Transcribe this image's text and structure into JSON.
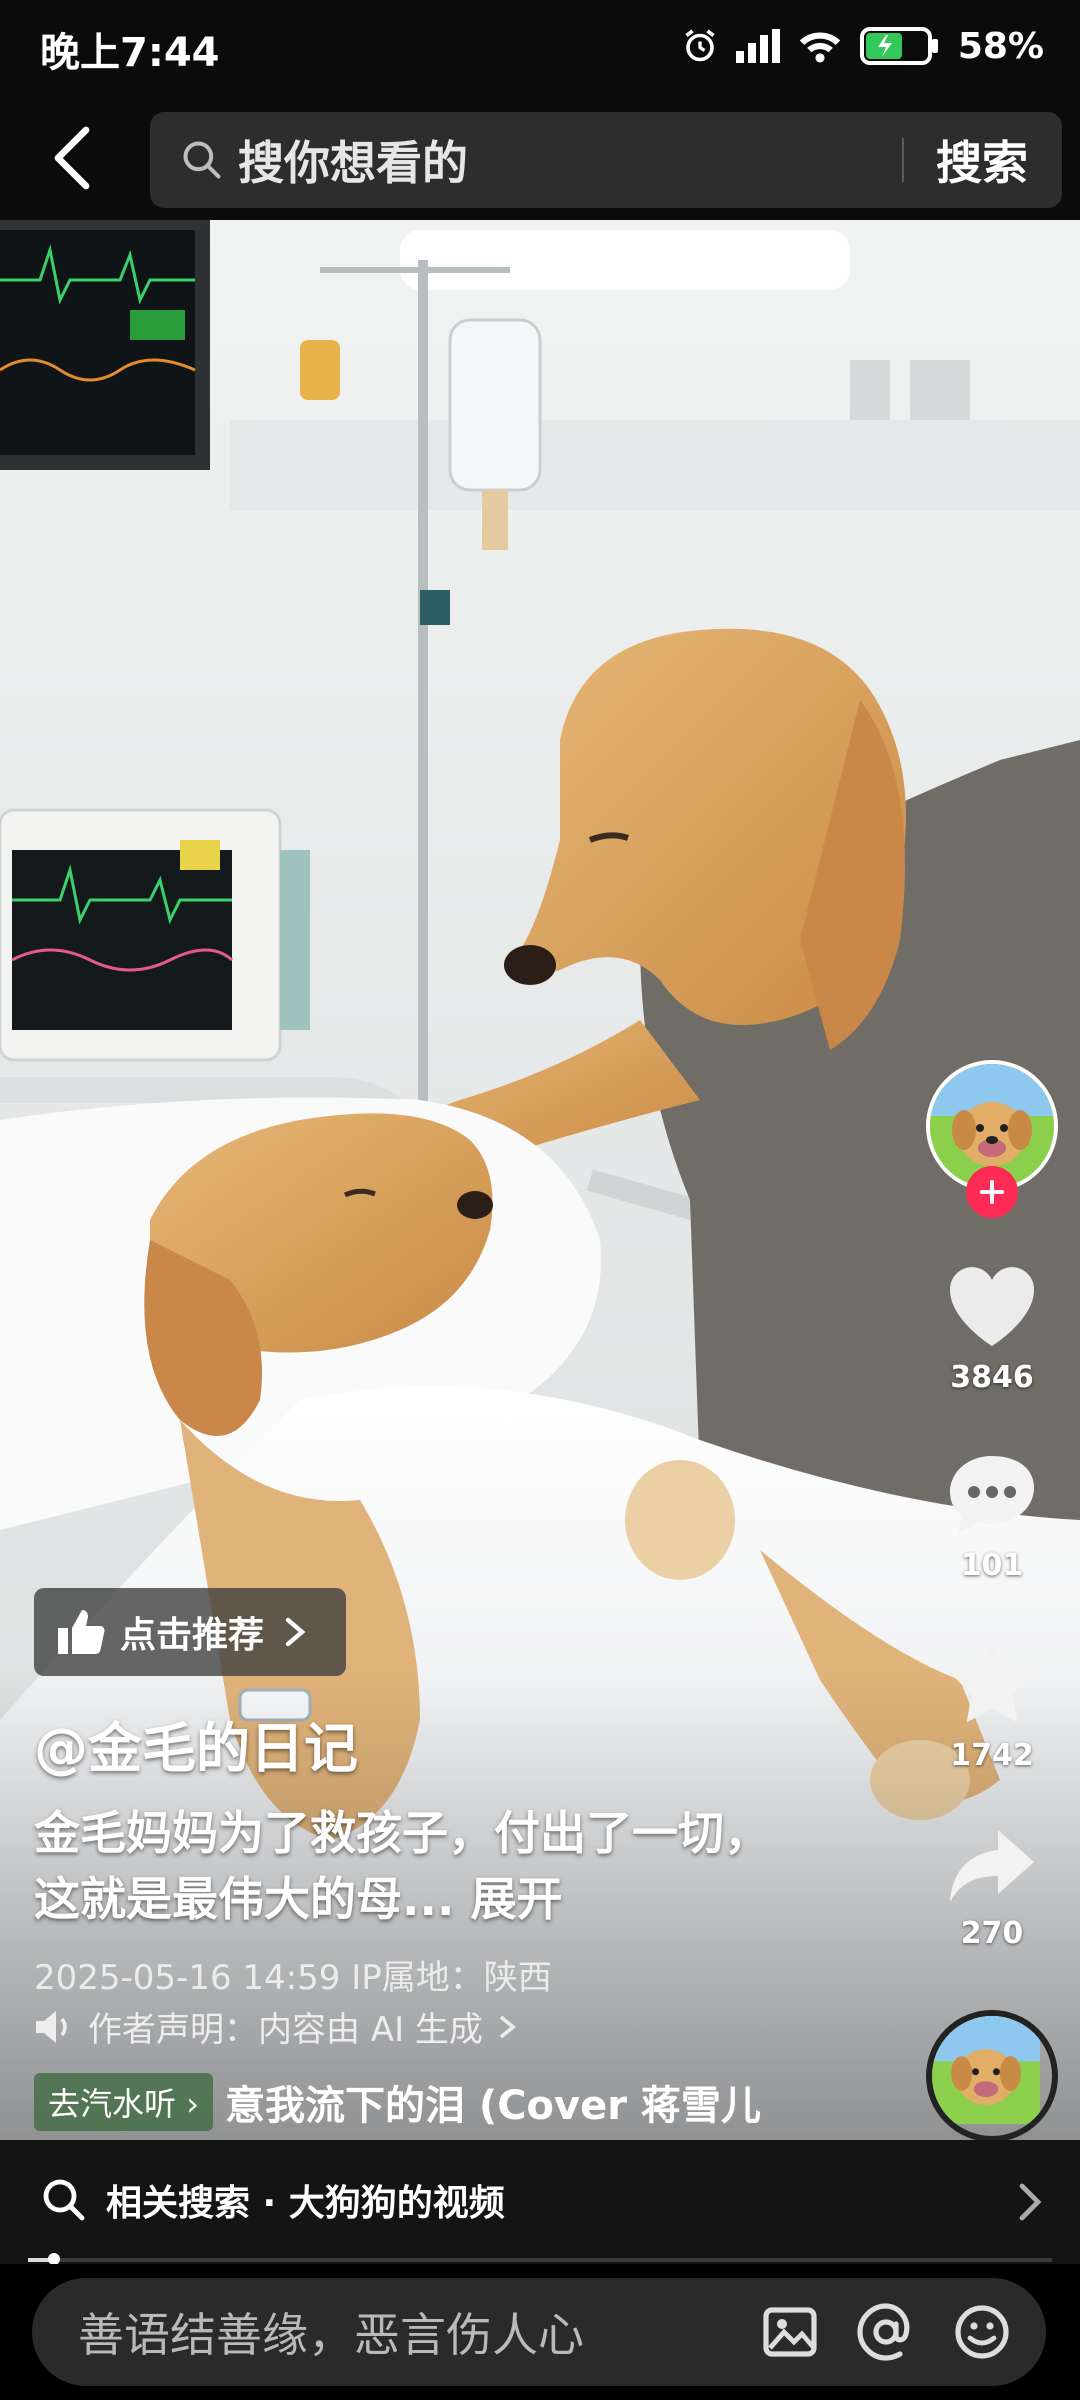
{
  "status_bar": {
    "time": "晚上7:44",
    "battery": "58%"
  },
  "header": {
    "search_placeholder": "搜你想看的",
    "search_button": "搜索"
  },
  "video": {
    "likes": "3846",
    "comments": "101",
    "favorites": "1742",
    "shares": "270",
    "recommend_label": "点击推荐",
    "author": "@金毛的日记",
    "description": "金毛妈妈为了救孩子，付出了一切，这就是最伟大的母...",
    "expand": "展开",
    "date_location": "2025-05-16 14:59  IP属地：陕西",
    "ai_notice": "作者声明：内容由 AI 生成",
    "music_tag": "去汽水听",
    "music_title": "意我流下的泪 (Cover 蒋雪儿"
  },
  "related_search": "相关搜索 · 大狗狗的视频",
  "comment_placeholder": "善语结善缘，恶言伤人心",
  "colors": {
    "accent_red": "#fe2c55",
    "search_bg": "#2d2d2d",
    "battery_green": "#34c759"
  }
}
